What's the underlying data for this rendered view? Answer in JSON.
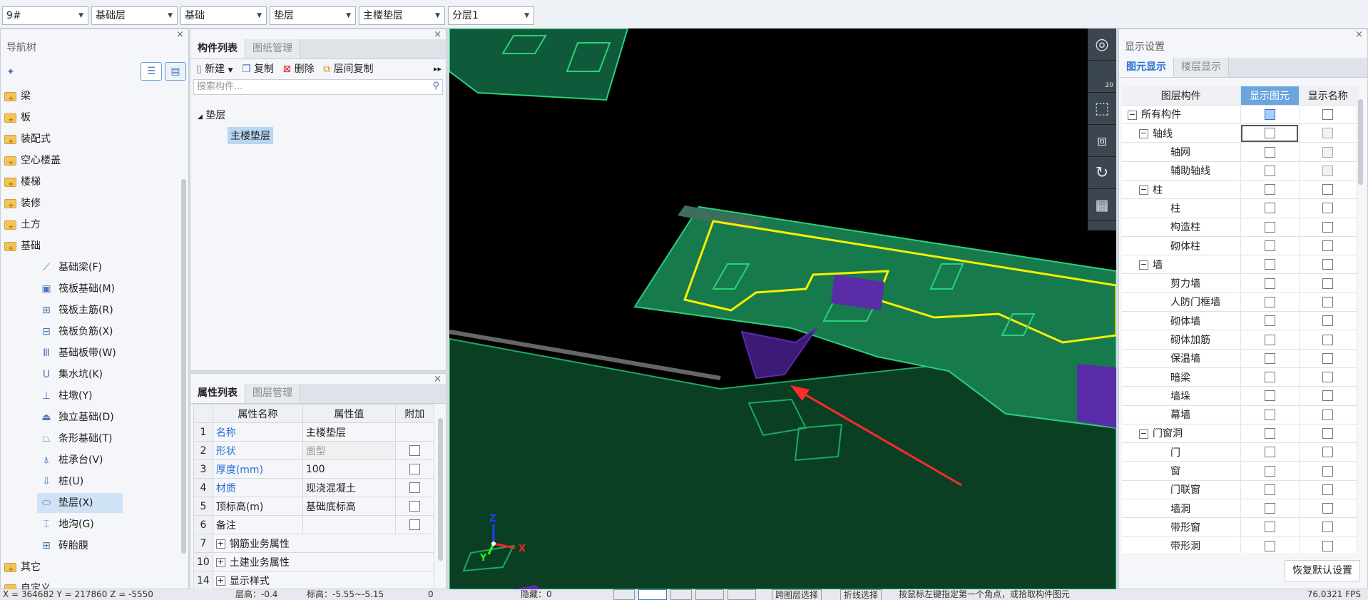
{
  "toolbar": {
    "selects": [
      "9#",
      "基础层",
      "基础",
      "垫层",
      "主楼垫层",
      "分层1"
    ]
  },
  "nav": {
    "title": "导航树",
    "items": [
      "梁",
      "板",
      "装配式",
      "空心楼盖",
      "楼梯",
      "装修",
      "土方",
      "基础"
    ],
    "sub_items": [
      "基础梁(F)",
      "筏板基础(M)",
      "筏板主筋(R)",
      "筏板负筋(X)",
      "基础板带(W)",
      "集水坑(K)",
      "柱墩(Y)",
      "独立基础(D)",
      "条形基础(T)",
      "桩承台(V)",
      "桩(U)",
      "垫层(X)",
      "地沟(G)",
      "砖胎膜"
    ],
    "after_items": [
      "其它",
      "自定义"
    ]
  },
  "component_list": {
    "tabs": [
      "构件列表",
      "图纸管理"
    ],
    "actions": [
      "新建",
      "复制",
      "删除",
      "层间复制"
    ],
    "search_placeholder": "搜索构件...",
    "tree_root": "垫层",
    "tree_child": "主楼垫层"
  },
  "properties": {
    "tabs": [
      "属性列表",
      "图层管理"
    ],
    "headers": [
      "属性名称",
      "属性值",
      "附加"
    ],
    "rows": [
      {
        "no": "1",
        "name": "名称",
        "value": "主楼垫层"
      },
      {
        "no": "2",
        "name": "形状",
        "value": "面型"
      },
      {
        "no": "3",
        "name": "厚度(mm)",
        "value": "100"
      },
      {
        "no": "4",
        "name": "材质",
        "value": "现浇混凝土"
      },
      {
        "no": "5",
        "name": "顶标高(m)",
        "value": "基础底标高"
      },
      {
        "no": "6",
        "name": "备注",
        "value": ""
      },
      {
        "no": "7",
        "name": "钢筋业务属性",
        "value": ""
      },
      {
        "no": "10",
        "name": "土建业务属性",
        "value": ""
      },
      {
        "no": "14",
        "name": "显示样式",
        "value": ""
      }
    ]
  },
  "display": {
    "title": "显示设置",
    "tabs": [
      "图元显示",
      "楼层显示"
    ],
    "headers": [
      "图层构件",
      "显示图元",
      "显示名称"
    ],
    "rows": [
      {
        "label": "所有构件",
        "level": 0,
        "group": true
      },
      {
        "label": "轴线",
        "level": 1,
        "group": true
      },
      {
        "label": "轴网",
        "level": 2,
        "group": false
      },
      {
        "label": "辅助轴线",
        "level": 2,
        "group": false
      },
      {
        "label": "柱",
        "level": 1,
        "group": true
      },
      {
        "label": "柱",
        "level": 2,
        "group": false
      },
      {
        "label": "构造柱",
        "level": 2,
        "group": false
      },
      {
        "label": "砌体柱",
        "level": 2,
        "group": false
      },
      {
        "label": "墙",
        "level": 1,
        "group": true
      },
      {
        "label": "剪力墙",
        "level": 2,
        "group": false
      },
      {
        "label": "人防门框墙",
        "level": 2,
        "group": false
      },
      {
        "label": "砌体墙",
        "level": 2,
        "group": false
      },
      {
        "label": "砌体加筋",
        "level": 2,
        "group": false
      },
      {
        "label": "保温墙",
        "level": 2,
        "group": false
      },
      {
        "label": "暗梁",
        "level": 2,
        "group": false
      },
      {
        "label": "墙垛",
        "level": 2,
        "group": false
      },
      {
        "label": "幕墙",
        "level": 2,
        "group": false
      },
      {
        "label": "门窗洞",
        "level": 1,
        "group": true
      },
      {
        "label": "门",
        "level": 2,
        "group": false
      },
      {
        "label": "窗",
        "level": 2,
        "group": false
      },
      {
        "label": "门联窗",
        "level": 2,
        "group": false
      },
      {
        "label": "墙洞",
        "level": 2,
        "group": false
      },
      {
        "label": "带形窗",
        "level": 2,
        "group": false
      },
      {
        "label": "带形洞",
        "level": 2,
        "group": false
      }
    ],
    "restore_button": "恢复默认设置"
  },
  "viewport": {
    "zoom_label": "20",
    "axis_x": "X",
    "axis_y": "Y",
    "axis_z": "Z"
  },
  "status": {
    "coords": "X = 364682  Y = 217860  Z = -5550",
    "floor_height": "层高：-0.4",
    "elevation": "标高：-5.55~-5.15",
    "extra": "0",
    "hidden": "隐藏：0",
    "btn1": "跨图层选择",
    "btn2": "折线选择",
    "hint": "按鼠标左键指定第一个角点，或拾取构件图元",
    "scale": "76.0321 FPS"
  }
}
